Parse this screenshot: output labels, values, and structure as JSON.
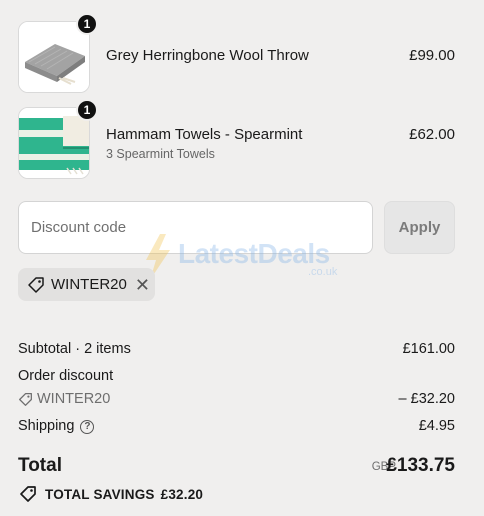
{
  "cart": {
    "items": [
      {
        "name": "Grey Herringbone Wool Throw",
        "variant": "",
        "price": "£99.00",
        "quantity": "1",
        "image_icon": "folded-grey-throw-image"
      },
      {
        "name": "Hammam Towels - Spearmint",
        "variant": "3 Spearmint Towels",
        "price": "£62.00",
        "quantity": "1",
        "image_icon": "spearmint-towel-image"
      }
    ]
  },
  "discount": {
    "placeholder": "Discount code",
    "apply_label": "Apply",
    "applied_code": "WINTER20",
    "remove_icon": "✕"
  },
  "watermark": {
    "text": "LatestDeals",
    "sub": ".co.uk"
  },
  "summary": {
    "subtotal_label": "Subtotal · 2 items",
    "subtotal_value": "£161.00",
    "order_discount_label": "Order discount",
    "order_discount_code": "WINTER20",
    "order_discount_value": "– £32.20",
    "shipping_label": "Shipping",
    "shipping_help": "?",
    "shipping_value": "£4.95",
    "total_label": "Total",
    "currency": "GBP",
    "total_value": "£133.75",
    "savings_label": "TOTAL SAVINGS",
    "savings_value": "£32.20"
  },
  "colors": {
    "background": "#f0efee",
    "towel_green": "#2fb58e",
    "throw_grey": "#9a9a9a"
  }
}
